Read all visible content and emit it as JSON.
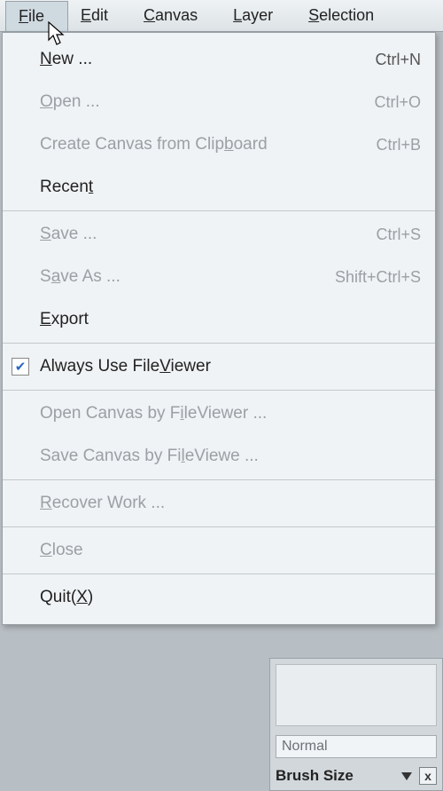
{
  "menubar": {
    "items": [
      {
        "pre": "",
        "u": "F",
        "post": "ile",
        "active": true
      },
      {
        "pre": "",
        "u": "E",
        "post": "dit",
        "active": false
      },
      {
        "pre": "",
        "u": "C",
        "post": "anvas",
        "active": false
      },
      {
        "pre": "",
        "u": "L",
        "post": "ayer",
        "active": false
      },
      {
        "pre": "",
        "u": "S",
        "post": "election",
        "active": false
      }
    ]
  },
  "file_menu": {
    "new": {
      "pre": "",
      "u": "N",
      "post": "ew ...",
      "shortcut": "Ctrl+N",
      "disabled": false
    },
    "open": {
      "pre": "",
      "u": "O",
      "post": "pen ...",
      "shortcut": "Ctrl+O",
      "disabled": true
    },
    "from_clip": {
      "pre": "Create Canvas from Clip",
      "u": "b",
      "post": "oard",
      "shortcut": "Ctrl+B",
      "disabled": true
    },
    "recent": {
      "pre": "Recen",
      "u": "t",
      "post": "",
      "shortcut": "",
      "disabled": false
    },
    "save": {
      "pre": "",
      "u": "S",
      "post": "ave ...",
      "shortcut": "Ctrl+S",
      "disabled": true
    },
    "save_as": {
      "pre": "S",
      "u": "a",
      "post": "ve As ...",
      "shortcut": "Shift+Ctrl+S",
      "disabled": true
    },
    "export": {
      "pre": "",
      "u": "E",
      "post": "xport",
      "shortcut": "",
      "disabled": false
    },
    "always_fv": {
      "pre": "Always Use File",
      "u": "V",
      "post": "iewer",
      "shortcut": "",
      "disabled": false,
      "checked": true
    },
    "open_fv": {
      "pre": "Open Canvas by F",
      "u": "i",
      "post": "leViewer ...",
      "shortcut": "",
      "disabled": true
    },
    "save_fv": {
      "pre": "Save Canvas by Fi",
      "u": "l",
      "post": "eViewe ...",
      "shortcut": "",
      "disabled": true
    },
    "recover": {
      "pre": "",
      "u": "R",
      "post": "ecover Work ...",
      "shortcut": "",
      "disabled": true
    },
    "close": {
      "pre": "",
      "u": "C",
      "post": "lose",
      "shortcut": "",
      "disabled": true
    },
    "quit": {
      "pre": "Quit(",
      "u": "X",
      "post": ")",
      "shortcut": "",
      "disabled": false
    }
  },
  "brush_panel": {
    "blend_mode": "Normal",
    "size_label": "Brush Size",
    "close_glyph": "x"
  }
}
